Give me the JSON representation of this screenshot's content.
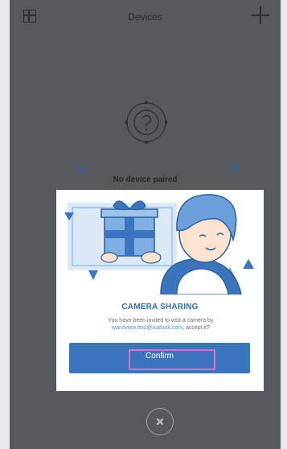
{
  "header": {
    "title": "Devices",
    "left_icon": "grid-icon",
    "right_icon": "plus-icon"
  },
  "empty_state": {
    "icon": "question-icon",
    "message": "No device paired"
  },
  "dialog": {
    "illustration": "gift-sharing-illustration",
    "title": "CAMERA SHARING",
    "message_prefix": "You have been invited to visit a camera by",
    "email": "wansview.test@outlook.com",
    "message_suffix": ", accept it?",
    "confirm_label": "Confirm"
  },
  "close": {
    "icon": "close-icon"
  },
  "colors": {
    "overlay": "#56595d",
    "accent": "#3b75bd",
    "highlight": "#e46ad2",
    "title_blue": "#2f6fb1"
  }
}
